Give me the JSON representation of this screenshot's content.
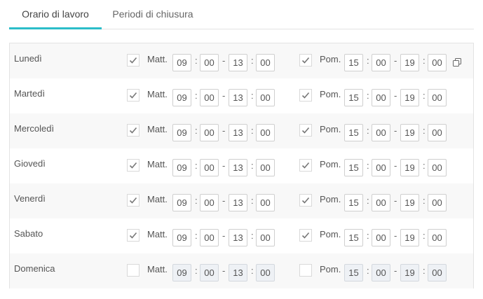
{
  "tabs": [
    {
      "label": "Orario di lavoro",
      "active": true
    },
    {
      "label": "Periodi di chiusura",
      "active": false
    }
  ],
  "accent_color": "#2bbdc9",
  "labels": {
    "morning": "Matt.",
    "afternoon": "Pom."
  },
  "separators": {
    "colon": ":",
    "dash": "-"
  },
  "days": [
    {
      "name": "Lunedì",
      "morning_checked": true,
      "afternoon_checked": true,
      "morning": {
        "from_h": "09",
        "from_m": "00",
        "to_h": "13",
        "to_m": "00"
      },
      "afternoon": {
        "from_h": "15",
        "from_m": "00",
        "to_h": "19",
        "to_m": "00"
      },
      "copy_icon": true
    },
    {
      "name": "Martedì",
      "morning_checked": true,
      "afternoon_checked": true,
      "morning": {
        "from_h": "09",
        "from_m": "00",
        "to_h": "13",
        "to_m": "00"
      },
      "afternoon": {
        "from_h": "15",
        "from_m": "00",
        "to_h": "19",
        "to_m": "00"
      }
    },
    {
      "name": "Mercoledì",
      "morning_checked": true,
      "afternoon_checked": true,
      "morning": {
        "from_h": "09",
        "from_m": "00",
        "to_h": "13",
        "to_m": "00"
      },
      "afternoon": {
        "from_h": "15",
        "from_m": "00",
        "to_h": "19",
        "to_m": "00"
      }
    },
    {
      "name": "Giovedì",
      "morning_checked": true,
      "afternoon_checked": true,
      "morning": {
        "from_h": "09",
        "from_m": "00",
        "to_h": "13",
        "to_m": "00"
      },
      "afternoon": {
        "from_h": "15",
        "from_m": "00",
        "to_h": "19",
        "to_m": "00"
      }
    },
    {
      "name": "Venerdì",
      "morning_checked": true,
      "afternoon_checked": true,
      "morning": {
        "from_h": "09",
        "from_m": "00",
        "to_h": "13",
        "to_m": "00"
      },
      "afternoon": {
        "from_h": "15",
        "from_m": "00",
        "to_h": "19",
        "to_m": "00"
      }
    },
    {
      "name": "Sabato",
      "morning_checked": true,
      "afternoon_checked": true,
      "morning": {
        "from_h": "09",
        "from_m": "00",
        "to_h": "13",
        "to_m": "00"
      },
      "afternoon": {
        "from_h": "15",
        "from_m": "00",
        "to_h": "19",
        "to_m": "00"
      }
    },
    {
      "name": "Domenica",
      "morning_checked": false,
      "afternoon_checked": false,
      "morning": {
        "from_h": "09",
        "from_m": "00",
        "to_h": "13",
        "to_m": "00"
      },
      "afternoon": {
        "from_h": "15",
        "from_m": "00",
        "to_h": "19",
        "to_m": "00"
      }
    }
  ]
}
